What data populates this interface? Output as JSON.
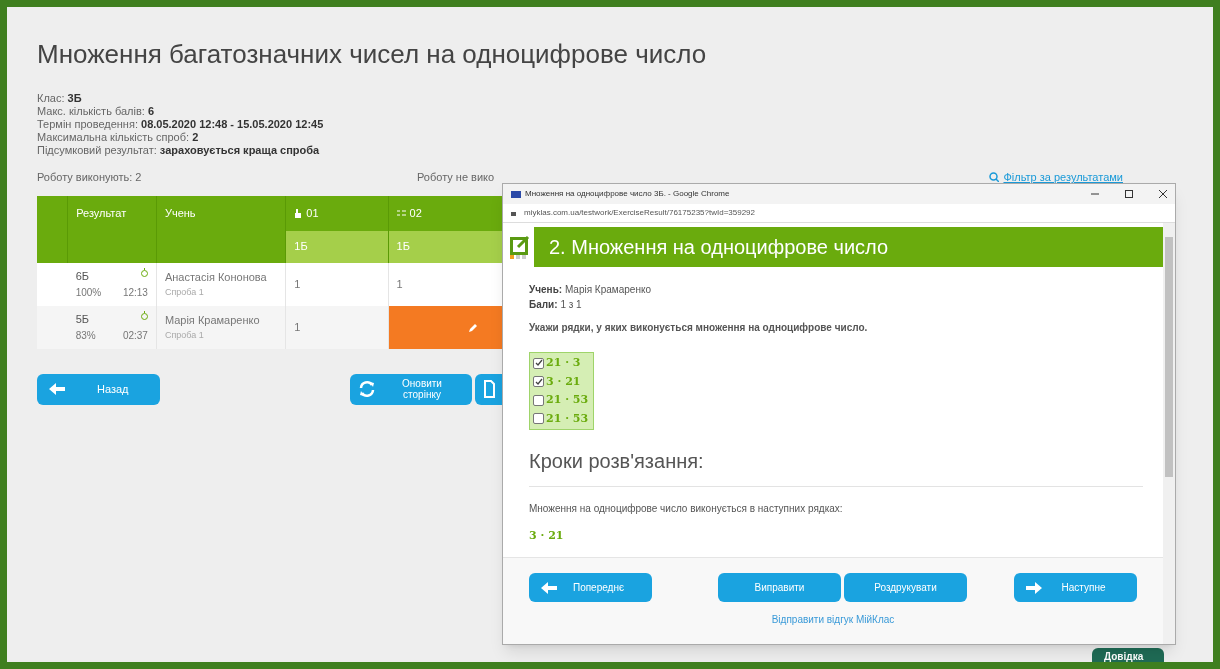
{
  "title": "Множення багатозначних чисел на одноцифрове число",
  "info": [
    {
      "label": "Клас:",
      "value": "3Б"
    },
    {
      "label": "Макс. кількість балів:",
      "value": "6"
    },
    {
      "label": "Термін проведення:",
      "value": "08.05.2020 12:48 - 15.05.2020 12:45"
    },
    {
      "label": "Максимальна кількість спроб:",
      "value": "2"
    },
    {
      "label": "Підсумковий результат:",
      "value": "зараховується краща спроба"
    }
  ],
  "summary": {
    "doing": "Роботу виконують: 2",
    "not_doing": "Роботу не вико",
    "filter_link": "Фільтр за результатами"
  },
  "table": {
    "columns": [
      {
        "label": "Результат"
      },
      {
        "label": "Учень"
      },
      {
        "label": "01",
        "kind": "pointer",
        "points": "1Б"
      },
      {
        "label": "02",
        "kind": "choice",
        "points": "1Б"
      }
    ],
    "rows": [
      {
        "score": "6Б",
        "percent": "100%",
        "time": "12:13",
        "student": "Анастасія Кононова",
        "attempt": "Спроба 1",
        "answers": [
          {
            "kind": "value",
            "text": "1"
          },
          {
            "kind": "value",
            "text": "1"
          }
        ]
      },
      {
        "score": "5Б",
        "percent": "83%",
        "time": "02:37",
        "student": "Марія Крамаренко",
        "attempt": "Спроба 1",
        "answers": [
          {
            "kind": "value",
            "text": "1"
          },
          {
            "kind": "edit"
          }
        ]
      }
    ]
  },
  "buttons": {
    "back": "Назад",
    "refresh": "Оновити сторінку"
  },
  "popup": {
    "window_title": "Множення на одноцифрове число 3Б. - Google Chrome",
    "url": "miyklas.com.ua/testwork/ExerciseResult/76175235?twId=359292",
    "heading": "2. Множення на одноцифрове число",
    "student_label": "Учень:",
    "student": "Марія Крамаренко",
    "points_label": "Бали:",
    "points": "1 з 1",
    "question": "Укажи рядки, у яких виконується множення на одноцифрове число.",
    "options": [
      {
        "text": "21 · 3",
        "checked": true
      },
      {
        "text": "3 · 21",
        "checked": true
      },
      {
        "text": "21 · 53",
        "checked": false
      },
      {
        "text": "21 · 53",
        "checked": false
      }
    ],
    "steps_heading": "Кроки розв'язання:",
    "steps_text": "Множення на одноцифрове число виконується в наступних рядках:",
    "steps_answer": "3 · 21",
    "buttons": [
      {
        "kind": "prev",
        "label": "Попереднє"
      },
      {
        "kind": "plain",
        "label": "Виправити"
      },
      {
        "kind": "plain",
        "label": "Роздрукувати"
      },
      {
        "kind": "next",
        "label": "Наступне"
      }
    ],
    "feedback_link": "Відправити відгук МійКлас"
  },
  "help_badge": "Довідка"
}
